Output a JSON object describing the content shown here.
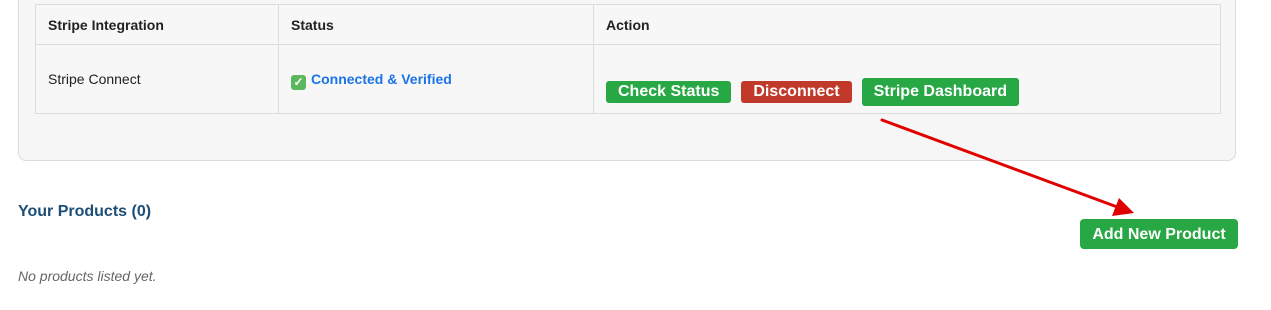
{
  "integrations_table": {
    "headers": [
      "Stripe Integration",
      "Status",
      "Action"
    ],
    "row": {
      "name": "Stripe Connect",
      "status_icon": "check-mark-icon",
      "status": "Connected & Verified",
      "actions": {
        "check_status": "Check Status",
        "disconnect": "Disconnect",
        "dashboard": "Stripe Dashboard"
      }
    }
  },
  "products": {
    "title": "Your Products (0)",
    "add_button": "Add New Product",
    "empty_note": "No products listed yet."
  },
  "colors": {
    "green": "#28a745",
    "red": "#c0392b",
    "link_blue": "#1a73e8",
    "title_blue": "#1d4e75",
    "annotation_arrow": "#e00000"
  }
}
